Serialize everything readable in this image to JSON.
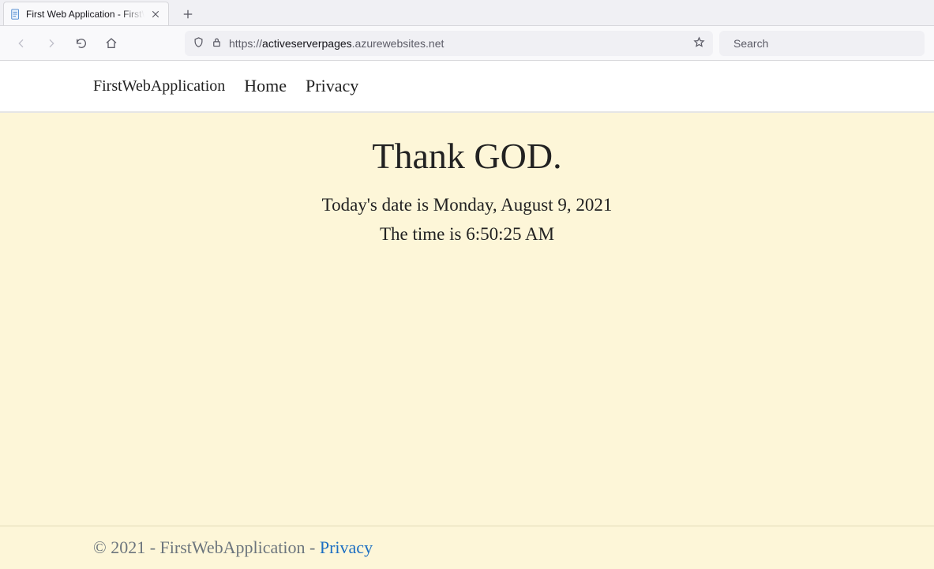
{
  "browser": {
    "tab": {
      "title": "First Web Application - FirstWebApplication"
    },
    "url": {
      "scheme": "https://",
      "host": "activeserverpages",
      "rest": ".azurewebsites.net"
    },
    "search_placeholder": "Search"
  },
  "page": {
    "navbar": {
      "brand": "FirstWebApplication",
      "links": {
        "home": "Home",
        "privacy": "Privacy"
      }
    },
    "heading": "Thank GOD.",
    "date_line": "Today's date is Monday, August 9, 2021",
    "time_line": "The time is 6:50:25 AM",
    "footer": {
      "text": "© 2021 - FirstWebApplication - ",
      "privacy_link": "Privacy"
    }
  }
}
